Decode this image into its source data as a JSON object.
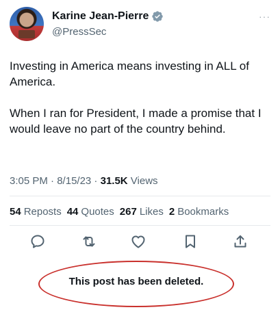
{
  "author": {
    "name": "Karine Jean-Pierre",
    "handle": "@PressSec",
    "verified_color": "#829aab"
  },
  "more_menu": "···",
  "tweet": {
    "paragraph1": "Investing in America means investing in ALL of America.",
    "paragraph2": "When I ran for President, I made a promise that I would leave no part of the country behind."
  },
  "meta": {
    "time": "3:05 PM",
    "sep1": " · ",
    "date": "8/15/23",
    "sep2": " · ",
    "views_count": "31.5K",
    "views_label": " Views"
  },
  "stats": {
    "reposts_count": "54",
    "reposts_label": "Reposts",
    "quotes_count": "44",
    "quotes_label": "Quotes",
    "likes_count": "267",
    "likes_label": "Likes",
    "bookmarks_count": "2",
    "bookmarks_label": "Bookmarks"
  },
  "actions": [
    "reply-icon",
    "repost-icon",
    "like-icon",
    "bookmark-icon",
    "share-icon"
  ],
  "annotation": {
    "text": "This post has been deleted.",
    "oval_color": "#c9302c"
  },
  "colors": {
    "text_primary": "#0f1419",
    "text_secondary": "#536471",
    "icon_gray": "#536471"
  }
}
